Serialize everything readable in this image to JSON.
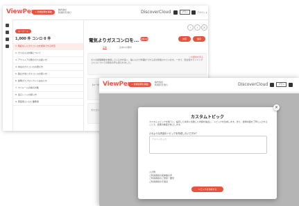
{
  "app": {
    "logo": "ViewPers",
    "new_chat_button": "+ 新規質問を開始",
    "user_line1": "株式会社",
    "user_line2": "利用状況 残り",
    "brand": "DiscoverCloud",
    "plan_badge": "プラン",
    "account": "アカウント"
  },
  "window1": {
    "search_tag": "キーワード",
    "search_summary": "1,000 件 コンロ 0 件",
    "sidebar_items": [
      "1. 暗証なしにガスコンロを使用できる状況",
      "2. ガスの火災対策について",
      "3. アウトドアの際のガスの扱い方",
      "4. 中古のガスコンロの選び方",
      "5. 組立方法とガスコンロの使い方",
      "6. 説明ガスプロンカットはなにか",
      "7. ワンルームの換気対策",
      "8. 電子レンジの扱い方",
      "9. 家庭用コンロと業務用"
    ],
    "thread_title": "電気よりガスコンロを...",
    "tab_all": "全体",
    "tab_summary": "生成AIの要約",
    "action_1": "共有",
    "action_2": "保存",
    "card_link": "この発言を見る",
    "card_texts": [
      "ガスの調理機能を重視している方が多く、強い火力で料理ができる点が評価されています。一方で、安全性やランニングコストについての懸念の声も見られました。",
      "【ユーザーの声】 ガスコンロは火力が強く、炒め物などの料理がおいしく仕上がると感じている。電気よりも好み。"
    ],
    "card_extra": "ガスコンロは調理が楽しく、料理のバリエーションが広がったという意見も多く寄せられています。"
  },
  "window2": {
    "modal": {
      "title": "カスタムトピック",
      "description": "カスタムトピックを使うと、設定した条件に合致した内容を抽出し、トピックを生成します。また、質問内容を丁寧に入力することで、結果の精度が向上します。",
      "field_label": "どのような内容のトピックを作成したいですか？",
      "placeholder": "テキストを入力",
      "examples": [
        "入力例",
        "ご利用者様の実体験の声",
        "ご利用者様のご意見・要望",
        "ご利用者様の不満点"
      ],
      "submit_button": "トピックを作成する",
      "close": "×"
    }
  },
  "colors": {
    "accent": "#e8533f",
    "logo": "#e85b4a"
  }
}
